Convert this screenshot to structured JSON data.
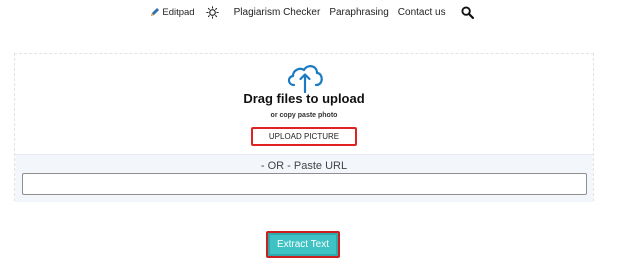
{
  "nav": {
    "brand": "Editpad",
    "brand_icon": "pencil-icon",
    "theme_icon": "sun-icon",
    "links": [
      "Plagiarism Checker",
      "Paraphrasing",
      "Contact us"
    ],
    "search_icon": "search-icon"
  },
  "upload": {
    "icon": "cloud-upload-icon",
    "accent_color": "#1a7ac2",
    "title": "Drag files to upload",
    "subtitle": "or copy paste photo",
    "button_label": "UPLOAD PICTURE"
  },
  "url": {
    "or_label": "- OR - Paste URL",
    "value": "",
    "placeholder": ""
  },
  "extract": {
    "label": "Extract Text",
    "color": "#3fc2c4"
  }
}
